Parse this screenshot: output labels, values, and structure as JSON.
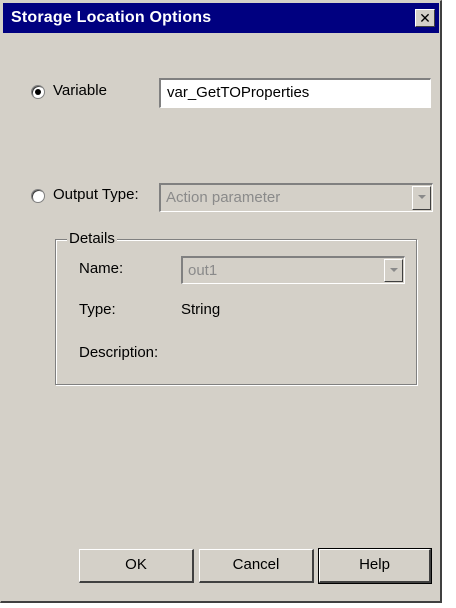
{
  "dialog": {
    "title": "Storage Location Options",
    "close_symbol": "✕"
  },
  "variable": {
    "radio_label": "Variable",
    "selected": true,
    "value": "var_GetTOProperties"
  },
  "output_type": {
    "radio_label": "Output Type:",
    "selected": false,
    "value": "Action parameter"
  },
  "details": {
    "group_label": "Details",
    "name_label": "Name:",
    "name_value": "out1",
    "type_label": "Type:",
    "type_value": "String",
    "description_label": "Description:",
    "description_value": ""
  },
  "buttons": {
    "ok": "OK",
    "cancel": "Cancel",
    "help": "Help"
  },
  "colors": {
    "titlebar": "#000080",
    "face": "#d4d0c8"
  }
}
